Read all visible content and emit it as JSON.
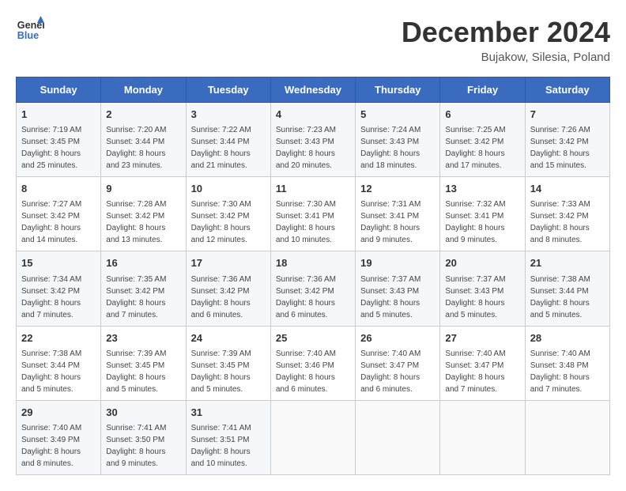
{
  "header": {
    "logo_line1": "General",
    "logo_line2": "Blue",
    "month_title": "December 2024",
    "location": "Bujakow, Silesia, Poland"
  },
  "weekdays": [
    "Sunday",
    "Monday",
    "Tuesday",
    "Wednesday",
    "Thursday",
    "Friday",
    "Saturday"
  ],
  "weeks": [
    [
      {
        "day": "1",
        "sunrise": "7:19 AM",
        "sunset": "3:45 PM",
        "daylight": "8 hours and 25 minutes."
      },
      {
        "day": "2",
        "sunrise": "7:20 AM",
        "sunset": "3:44 PM",
        "daylight": "8 hours and 23 minutes."
      },
      {
        "day": "3",
        "sunrise": "7:22 AM",
        "sunset": "3:44 PM",
        "daylight": "8 hours and 21 minutes."
      },
      {
        "day": "4",
        "sunrise": "7:23 AM",
        "sunset": "3:43 PM",
        "daylight": "8 hours and 20 minutes."
      },
      {
        "day": "5",
        "sunrise": "7:24 AM",
        "sunset": "3:43 PM",
        "daylight": "8 hours and 18 minutes."
      },
      {
        "day": "6",
        "sunrise": "7:25 AM",
        "sunset": "3:42 PM",
        "daylight": "8 hours and 17 minutes."
      },
      {
        "day": "7",
        "sunrise": "7:26 AM",
        "sunset": "3:42 PM",
        "daylight": "8 hours and 15 minutes."
      }
    ],
    [
      {
        "day": "8",
        "sunrise": "7:27 AM",
        "sunset": "3:42 PM",
        "daylight": "8 hours and 14 minutes."
      },
      {
        "day": "9",
        "sunrise": "7:28 AM",
        "sunset": "3:42 PM",
        "daylight": "8 hours and 13 minutes."
      },
      {
        "day": "10",
        "sunrise": "7:30 AM",
        "sunset": "3:42 PM",
        "daylight": "8 hours and 12 minutes."
      },
      {
        "day": "11",
        "sunrise": "7:30 AM",
        "sunset": "3:41 PM",
        "daylight": "8 hours and 10 minutes."
      },
      {
        "day": "12",
        "sunrise": "7:31 AM",
        "sunset": "3:41 PM",
        "daylight": "8 hours and 9 minutes."
      },
      {
        "day": "13",
        "sunrise": "7:32 AM",
        "sunset": "3:41 PM",
        "daylight": "8 hours and 9 minutes."
      },
      {
        "day": "14",
        "sunrise": "7:33 AM",
        "sunset": "3:42 PM",
        "daylight": "8 hours and 8 minutes."
      }
    ],
    [
      {
        "day": "15",
        "sunrise": "7:34 AM",
        "sunset": "3:42 PM",
        "daylight": "8 hours and 7 minutes."
      },
      {
        "day": "16",
        "sunrise": "7:35 AM",
        "sunset": "3:42 PM",
        "daylight": "8 hours and 7 minutes."
      },
      {
        "day": "17",
        "sunrise": "7:36 AM",
        "sunset": "3:42 PM",
        "daylight": "8 hours and 6 minutes."
      },
      {
        "day": "18",
        "sunrise": "7:36 AM",
        "sunset": "3:42 PM",
        "daylight": "8 hours and 6 minutes."
      },
      {
        "day": "19",
        "sunrise": "7:37 AM",
        "sunset": "3:43 PM",
        "daylight": "8 hours and 5 minutes."
      },
      {
        "day": "20",
        "sunrise": "7:37 AM",
        "sunset": "3:43 PM",
        "daylight": "8 hours and 5 minutes."
      },
      {
        "day": "21",
        "sunrise": "7:38 AM",
        "sunset": "3:44 PM",
        "daylight": "8 hours and 5 minutes."
      }
    ],
    [
      {
        "day": "22",
        "sunrise": "7:38 AM",
        "sunset": "3:44 PM",
        "daylight": "8 hours and 5 minutes."
      },
      {
        "day": "23",
        "sunrise": "7:39 AM",
        "sunset": "3:45 PM",
        "daylight": "8 hours and 5 minutes."
      },
      {
        "day": "24",
        "sunrise": "7:39 AM",
        "sunset": "3:45 PM",
        "daylight": "8 hours and 5 minutes."
      },
      {
        "day": "25",
        "sunrise": "7:40 AM",
        "sunset": "3:46 PM",
        "daylight": "8 hours and 6 minutes."
      },
      {
        "day": "26",
        "sunrise": "7:40 AM",
        "sunset": "3:47 PM",
        "daylight": "8 hours and 6 minutes."
      },
      {
        "day": "27",
        "sunrise": "7:40 AM",
        "sunset": "3:47 PM",
        "daylight": "8 hours and 7 minutes."
      },
      {
        "day": "28",
        "sunrise": "7:40 AM",
        "sunset": "3:48 PM",
        "daylight": "8 hours and 7 minutes."
      }
    ],
    [
      {
        "day": "29",
        "sunrise": "7:40 AM",
        "sunset": "3:49 PM",
        "daylight": "8 hours and 8 minutes."
      },
      {
        "day": "30",
        "sunrise": "7:41 AM",
        "sunset": "3:50 PM",
        "daylight": "8 hours and 9 minutes."
      },
      {
        "day": "31",
        "sunrise": "7:41 AM",
        "sunset": "3:51 PM",
        "daylight": "8 hours and 10 minutes."
      },
      null,
      null,
      null,
      null
    ]
  ]
}
